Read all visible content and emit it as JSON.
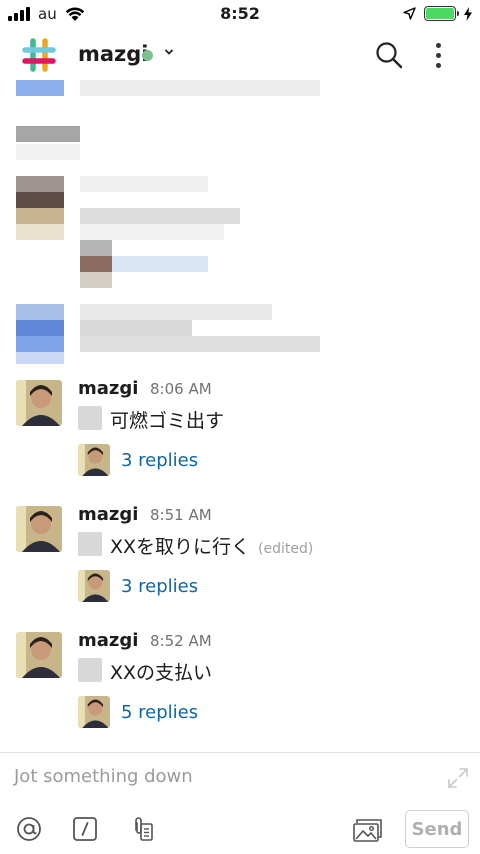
{
  "status_bar": {
    "carrier": "au",
    "time": "8:52",
    "battery_level": 1.0
  },
  "header": {
    "workspace_name": "mazgi",
    "presence_color": "#7dbf8e"
  },
  "messages": [
    {
      "author": "mazgi",
      "time": "8:06 AM",
      "text": "可燃ゴミ出す",
      "edited": "",
      "replies": "3 replies"
    },
    {
      "author": "mazgi",
      "time": "8:51 AM",
      "text": "XXを取りに行く",
      "edited": "(edited)",
      "replies": "3 replies"
    },
    {
      "author": "mazgi",
      "time": "8:52 AM",
      "text": "XXの支払い",
      "edited": "",
      "replies": "5 replies"
    }
  ],
  "composer": {
    "placeholder": "Jot something down",
    "send_label": "Send"
  },
  "colors": {
    "link": "#1264a3",
    "accent_green": "#4cd964"
  },
  "icons": [
    "signal-icon",
    "wifi-icon",
    "location-icon",
    "battery-icon",
    "charging-icon",
    "slack-logo-icon",
    "chevron-down-icon",
    "search-icon",
    "more-icon",
    "expand-icon",
    "mention-icon",
    "slash-command-icon",
    "attachment-icon",
    "photo-icon"
  ]
}
